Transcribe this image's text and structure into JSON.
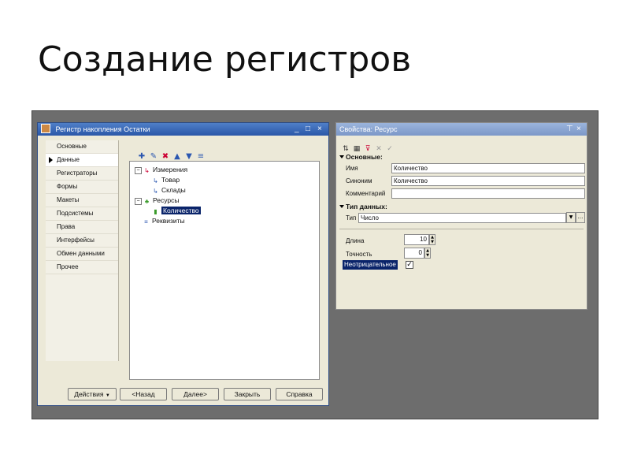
{
  "slide": {
    "title": "Создание регистров"
  },
  "left_window": {
    "title": "Регистр накопления Остатки",
    "controls": {
      "minimize": "_",
      "maximize": "□",
      "close": "×"
    },
    "nav_items": [
      {
        "label": "Основные"
      },
      {
        "label": "Данные"
      },
      {
        "label": "Регистраторы"
      },
      {
        "label": "Формы"
      },
      {
        "label": "Макеты"
      },
      {
        "label": "Подсистемы"
      },
      {
        "label": "Права"
      },
      {
        "label": "Интерфейсы"
      },
      {
        "label": "Обмен данными"
      },
      {
        "label": "Прочее"
      }
    ],
    "active_nav": "Данные",
    "tree": {
      "measurements": "Измерения",
      "item_goods": "Товар",
      "item_warehouses": "Склады",
      "resources": "Ресурсы",
      "item_quantity": "Количество",
      "requisites": "Реквизиты"
    },
    "buttons": {
      "actions": "Действия",
      "back": "<Назад",
      "next": "Далее>",
      "close": "Закрыть",
      "help": "Справка"
    }
  },
  "properties_window": {
    "title": "Свойства: Ресурс",
    "controls": {
      "pin": "ꟷ",
      "close": "×"
    },
    "section_main": "Основные:",
    "name_label": "Имя",
    "name_value": "Количество",
    "synonym_label": "Синоним",
    "synonym_value": "Количество",
    "comment_label": "Комментарий",
    "comment_value": "",
    "section_type": "Тип данных:",
    "type_label": "Тип",
    "type_value": "Число",
    "length_label": "Длина",
    "length_value": "10",
    "precision_label": "Точность",
    "precision_value": "0",
    "nonnegative_label": "Неотрицательное",
    "nonnegative_checked": "✓"
  },
  "colors": {
    "selection": "#0a246a",
    "titlebar_active": "#2a57a8",
    "titlebar_inactive": "#7c98c8",
    "window_bg": "#ece9d8",
    "desktop": "#6d6d6d"
  }
}
